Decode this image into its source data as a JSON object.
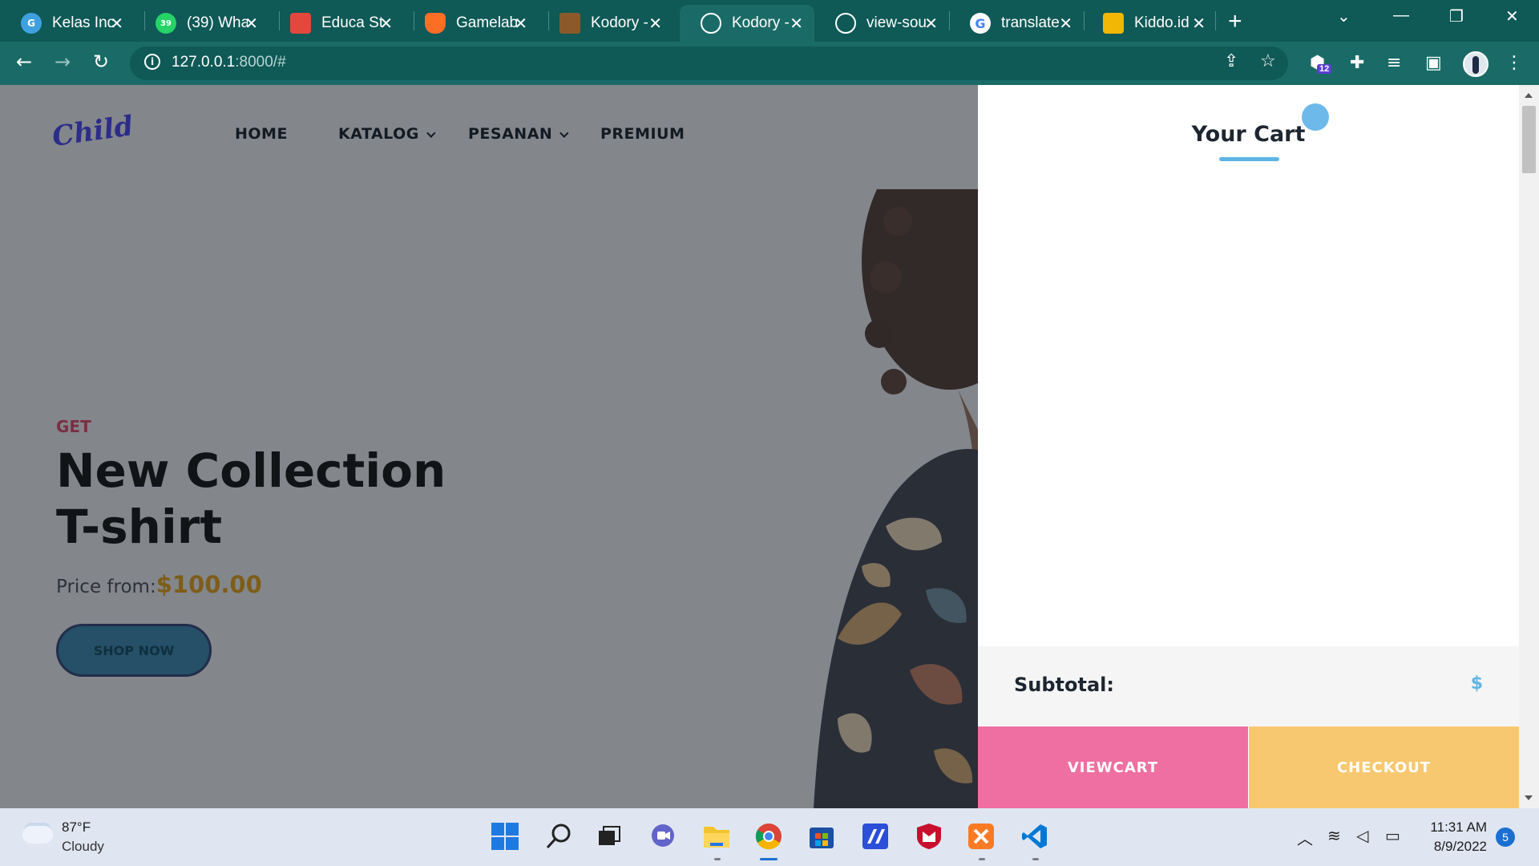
{
  "browser": {
    "tabs": [
      {
        "title": "Kelas Ind",
        "icon": "kelas-favicon",
        "color": "#3fa0e0"
      },
      {
        "title": "(39) Wha",
        "icon": "whatsapp-favicon",
        "color": "#25d366",
        "badge": "39"
      },
      {
        "title": "Educa St",
        "icon": "educa-favicon",
        "color": "#e2483b"
      },
      {
        "title": "Gamelab",
        "icon": "gitlab-favicon",
        "color": "#fc6d26"
      },
      {
        "title": "Kodory -",
        "icon": "kodory-favicon",
        "color": "#8a5a2b"
      },
      {
        "title": "Kodory -",
        "icon": "globe-favicon",
        "color": "#ffffff",
        "active": true
      },
      {
        "title": "view-sou",
        "icon": "globe-favicon",
        "color": "#ffffff"
      },
      {
        "title": "translate",
        "icon": "google-favicon",
        "color": "#4285f4"
      },
      {
        "title": "Kiddo.id",
        "icon": "kiddo-favicon",
        "color": "#f2b705"
      }
    ],
    "new_tab": "+",
    "address": {
      "host": "127.0.0.1",
      "rest": ":8000/#"
    },
    "extension_badge": "12"
  },
  "site": {
    "logo": "Child",
    "nav": [
      {
        "label": "HOME",
        "has_dropdown": false
      },
      {
        "label": "KATALOG",
        "has_dropdown": true
      },
      {
        "label": "PESANAN",
        "has_dropdown": true
      },
      {
        "label": "PREMIUM",
        "has_dropdown": false
      }
    ],
    "hero": {
      "kicker": "GET",
      "headline_line1": "New Collection",
      "headline_line2": "T-shirt",
      "price_label": "Price from:",
      "price_value": "$100.00",
      "cta": "SHOP NOW"
    }
  },
  "cart": {
    "title": "Your Cart",
    "subtotal_label": "Subtotal:",
    "subtotal_value": "$",
    "viewcart_label": "VIEWCART",
    "checkout_label": "CHECKOUT",
    "colors": {
      "accent": "#5fb4e5",
      "viewcart": "#ef6fa2",
      "checkout": "#f8c870"
    }
  },
  "taskbar": {
    "weather_temp": "87°F",
    "weather_cond": "Cloudy",
    "time": "11:31 AM",
    "date": "8/9/2022",
    "notifications": "5",
    "apps": [
      "windows-start-icon",
      "search-icon",
      "task-view-icon",
      "teams-chat-icon",
      "file-explorer-icon",
      "chrome-icon",
      "ms-store-icon",
      "app-icon",
      "mcafee-icon",
      "xampp-icon",
      "vscode-icon"
    ]
  }
}
